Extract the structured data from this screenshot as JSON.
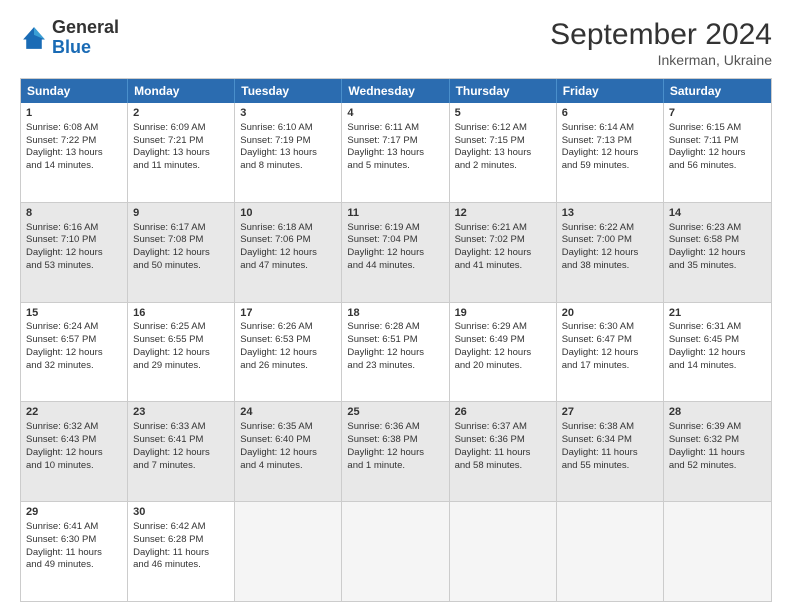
{
  "logo": {
    "general": "General",
    "blue": "Blue"
  },
  "title": "September 2024",
  "location": "Inkerman, Ukraine",
  "weekdays": [
    "Sunday",
    "Monday",
    "Tuesday",
    "Wednesday",
    "Thursday",
    "Friday",
    "Saturday"
  ],
  "weeks": [
    [
      {
        "day": "1",
        "lines": [
          "Sunrise: 6:08 AM",
          "Sunset: 7:22 PM",
          "Daylight: 13 hours",
          "and 14 minutes."
        ]
      },
      {
        "day": "2",
        "lines": [
          "Sunrise: 6:09 AM",
          "Sunset: 7:21 PM",
          "Daylight: 13 hours",
          "and 11 minutes."
        ]
      },
      {
        "day": "3",
        "lines": [
          "Sunrise: 6:10 AM",
          "Sunset: 7:19 PM",
          "Daylight: 13 hours",
          "and 8 minutes."
        ]
      },
      {
        "day": "4",
        "lines": [
          "Sunrise: 6:11 AM",
          "Sunset: 7:17 PM",
          "Daylight: 13 hours",
          "and 5 minutes."
        ]
      },
      {
        "day": "5",
        "lines": [
          "Sunrise: 6:12 AM",
          "Sunset: 7:15 PM",
          "Daylight: 13 hours",
          "and 2 minutes."
        ]
      },
      {
        "day": "6",
        "lines": [
          "Sunrise: 6:14 AM",
          "Sunset: 7:13 PM",
          "Daylight: 12 hours",
          "and 59 minutes."
        ]
      },
      {
        "day": "7",
        "lines": [
          "Sunrise: 6:15 AM",
          "Sunset: 7:11 PM",
          "Daylight: 12 hours",
          "and 56 minutes."
        ]
      }
    ],
    [
      {
        "day": "8",
        "lines": [
          "Sunrise: 6:16 AM",
          "Sunset: 7:10 PM",
          "Daylight: 12 hours",
          "and 53 minutes."
        ]
      },
      {
        "day": "9",
        "lines": [
          "Sunrise: 6:17 AM",
          "Sunset: 7:08 PM",
          "Daylight: 12 hours",
          "and 50 minutes."
        ]
      },
      {
        "day": "10",
        "lines": [
          "Sunrise: 6:18 AM",
          "Sunset: 7:06 PM",
          "Daylight: 12 hours",
          "and 47 minutes."
        ]
      },
      {
        "day": "11",
        "lines": [
          "Sunrise: 6:19 AM",
          "Sunset: 7:04 PM",
          "Daylight: 12 hours",
          "and 44 minutes."
        ]
      },
      {
        "day": "12",
        "lines": [
          "Sunrise: 6:21 AM",
          "Sunset: 7:02 PM",
          "Daylight: 12 hours",
          "and 41 minutes."
        ]
      },
      {
        "day": "13",
        "lines": [
          "Sunrise: 6:22 AM",
          "Sunset: 7:00 PM",
          "Daylight: 12 hours",
          "and 38 minutes."
        ]
      },
      {
        "day": "14",
        "lines": [
          "Sunrise: 6:23 AM",
          "Sunset: 6:58 PM",
          "Daylight: 12 hours",
          "and 35 minutes."
        ]
      }
    ],
    [
      {
        "day": "15",
        "lines": [
          "Sunrise: 6:24 AM",
          "Sunset: 6:57 PM",
          "Daylight: 12 hours",
          "and 32 minutes."
        ]
      },
      {
        "day": "16",
        "lines": [
          "Sunrise: 6:25 AM",
          "Sunset: 6:55 PM",
          "Daylight: 12 hours",
          "and 29 minutes."
        ]
      },
      {
        "day": "17",
        "lines": [
          "Sunrise: 6:26 AM",
          "Sunset: 6:53 PM",
          "Daylight: 12 hours",
          "and 26 minutes."
        ]
      },
      {
        "day": "18",
        "lines": [
          "Sunrise: 6:28 AM",
          "Sunset: 6:51 PM",
          "Daylight: 12 hours",
          "and 23 minutes."
        ]
      },
      {
        "day": "19",
        "lines": [
          "Sunrise: 6:29 AM",
          "Sunset: 6:49 PM",
          "Daylight: 12 hours",
          "and 20 minutes."
        ]
      },
      {
        "day": "20",
        "lines": [
          "Sunrise: 6:30 AM",
          "Sunset: 6:47 PM",
          "Daylight: 12 hours",
          "and 17 minutes."
        ]
      },
      {
        "day": "21",
        "lines": [
          "Sunrise: 6:31 AM",
          "Sunset: 6:45 PM",
          "Daylight: 12 hours",
          "and 14 minutes."
        ]
      }
    ],
    [
      {
        "day": "22",
        "lines": [
          "Sunrise: 6:32 AM",
          "Sunset: 6:43 PM",
          "Daylight: 12 hours",
          "and 10 minutes."
        ]
      },
      {
        "day": "23",
        "lines": [
          "Sunrise: 6:33 AM",
          "Sunset: 6:41 PM",
          "Daylight: 12 hours",
          "and 7 minutes."
        ]
      },
      {
        "day": "24",
        "lines": [
          "Sunrise: 6:35 AM",
          "Sunset: 6:40 PM",
          "Daylight: 12 hours",
          "and 4 minutes."
        ]
      },
      {
        "day": "25",
        "lines": [
          "Sunrise: 6:36 AM",
          "Sunset: 6:38 PM",
          "Daylight: 12 hours",
          "and 1 minute."
        ]
      },
      {
        "day": "26",
        "lines": [
          "Sunrise: 6:37 AM",
          "Sunset: 6:36 PM",
          "Daylight: 11 hours",
          "and 58 minutes."
        ]
      },
      {
        "day": "27",
        "lines": [
          "Sunrise: 6:38 AM",
          "Sunset: 6:34 PM",
          "Daylight: 11 hours",
          "and 55 minutes."
        ]
      },
      {
        "day": "28",
        "lines": [
          "Sunrise: 6:39 AM",
          "Sunset: 6:32 PM",
          "Daylight: 11 hours",
          "and 52 minutes."
        ]
      }
    ],
    [
      {
        "day": "29",
        "lines": [
          "Sunrise: 6:41 AM",
          "Sunset: 6:30 PM",
          "Daylight: 11 hours",
          "and 49 minutes."
        ]
      },
      {
        "day": "30",
        "lines": [
          "Sunrise: 6:42 AM",
          "Sunset: 6:28 PM",
          "Daylight: 11 hours",
          "and 46 minutes."
        ]
      },
      {
        "day": "",
        "lines": []
      },
      {
        "day": "",
        "lines": []
      },
      {
        "day": "",
        "lines": []
      },
      {
        "day": "",
        "lines": []
      },
      {
        "day": "",
        "lines": []
      }
    ]
  ]
}
